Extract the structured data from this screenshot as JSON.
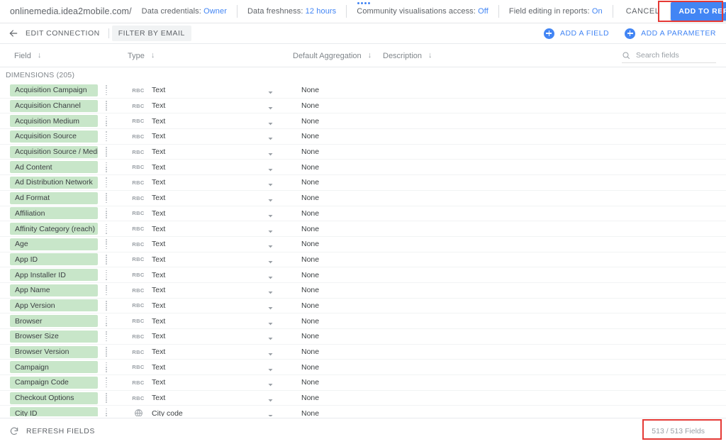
{
  "topbar": {
    "url": "onlinemedia.idea2mobile.com/",
    "loader_icon": "dots-loading-icon",
    "meta": [
      {
        "label": "Data credentials:",
        "value": "Owner",
        "name": "data-credentials"
      },
      {
        "label": "Data freshness:",
        "value": "12 hours",
        "name": "data-freshness"
      },
      {
        "label": "Community visualisations access:",
        "value": "Off",
        "name": "community-visualisations-access"
      },
      {
        "label": "Field editing in reports:",
        "value": "On",
        "name": "field-editing-in-reports"
      }
    ],
    "cancel_label": "CANCEL",
    "add_to_report_label": "ADD TO REPORT",
    "accent_blue": "#4285f4",
    "annotation_color": "#e53935"
  },
  "toolbar": {
    "back_icon": "arrow-left-icon",
    "edit_connection_label": "EDIT CONNECTION",
    "filter_by_email_label": "FILTER BY EMAIL",
    "add_field_label": "ADD A FIELD",
    "add_parameter_label": "ADD A PARAMETER",
    "add_icon": "plus-circle-icon"
  },
  "columns": {
    "field": "Field",
    "type": "Type",
    "default_aggregation": "Default Aggregation",
    "description": "Description",
    "sort_icon": "arrow-down-icon"
  },
  "search": {
    "placeholder": "Search fields",
    "value": "",
    "icon": "search-icon"
  },
  "section": {
    "dimensions_label": "DIMENSIONS (205)"
  },
  "rows": [
    {
      "field": "Acquisition Campaign",
      "type_icon": "abc-text-icon",
      "type_icon_text": "RBC",
      "type": "Text",
      "aggregation": "None"
    },
    {
      "field": "Acquisition Channel",
      "type_icon": "abc-text-icon",
      "type_icon_text": "RBC",
      "type": "Text",
      "aggregation": "None"
    },
    {
      "field": "Acquisition Medium",
      "type_icon": "abc-text-icon",
      "type_icon_text": "RBC",
      "type": "Text",
      "aggregation": "None"
    },
    {
      "field": "Acquisition Source",
      "type_icon": "abc-text-icon",
      "type_icon_text": "RBC",
      "type": "Text",
      "aggregation": "None"
    },
    {
      "field": "Acquisition Source / Medi...",
      "type_icon": "abc-text-icon",
      "type_icon_text": "RBC",
      "type": "Text",
      "aggregation": "None"
    },
    {
      "field": "Ad Content",
      "type_icon": "abc-text-icon",
      "type_icon_text": "RBC",
      "type": "Text",
      "aggregation": "None"
    },
    {
      "field": "Ad Distribution Network",
      "type_icon": "abc-text-icon",
      "type_icon_text": "RBC",
      "type": "Text",
      "aggregation": "None"
    },
    {
      "field": "Ad Format",
      "type_icon": "abc-text-icon",
      "type_icon_text": "RBC",
      "type": "Text",
      "aggregation": "None"
    },
    {
      "field": "Affiliation",
      "type_icon": "abc-text-icon",
      "type_icon_text": "RBC",
      "type": "Text",
      "aggregation": "None"
    },
    {
      "field": "Affinity Category (reach)",
      "type_icon": "abc-text-icon",
      "type_icon_text": "RBC",
      "type": "Text",
      "aggregation": "None"
    },
    {
      "field": "Age",
      "type_icon": "abc-text-icon",
      "type_icon_text": "RBC",
      "type": "Text",
      "aggregation": "None"
    },
    {
      "field": "App ID",
      "type_icon": "abc-text-icon",
      "type_icon_text": "RBC",
      "type": "Text",
      "aggregation": "None"
    },
    {
      "field": "App Installer ID",
      "type_icon": "abc-text-icon",
      "type_icon_text": "RBC",
      "type": "Text",
      "aggregation": "None"
    },
    {
      "field": "App Name",
      "type_icon": "abc-text-icon",
      "type_icon_text": "RBC",
      "type": "Text",
      "aggregation": "None"
    },
    {
      "field": "App Version",
      "type_icon": "abc-text-icon",
      "type_icon_text": "RBC",
      "type": "Text",
      "aggregation": "None"
    },
    {
      "field": "Browser",
      "type_icon": "abc-text-icon",
      "type_icon_text": "RBC",
      "type": "Text",
      "aggregation": "None"
    },
    {
      "field": "Browser Size",
      "type_icon": "abc-text-icon",
      "type_icon_text": "RBC",
      "type": "Text",
      "aggregation": "None"
    },
    {
      "field": "Browser Version",
      "type_icon": "abc-text-icon",
      "type_icon_text": "RBC",
      "type": "Text",
      "aggregation": "None"
    },
    {
      "field": "Campaign",
      "type_icon": "abc-text-icon",
      "type_icon_text": "RBC",
      "type": "Text",
      "aggregation": "None"
    },
    {
      "field": "Campaign Code",
      "type_icon": "abc-text-icon",
      "type_icon_text": "RBC",
      "type": "Text",
      "aggregation": "None"
    },
    {
      "field": "Checkout Options",
      "type_icon": "abc-text-icon",
      "type_icon_text": "RBC",
      "type": "Text",
      "aggregation": "None"
    },
    {
      "field": "City ID",
      "type_icon": "globe-icon",
      "type_icon_text": "",
      "type": "City code",
      "aggregation": "None"
    },
    {
      "field": "",
      "type_icon": "",
      "type_icon_text": "",
      "type": "",
      "aggregation": ""
    }
  ],
  "bottombar": {
    "refresh_icon": "refresh-icon",
    "refresh_label": "REFRESH FIELDS",
    "fields_count": "513 / 513 Fields"
  }
}
